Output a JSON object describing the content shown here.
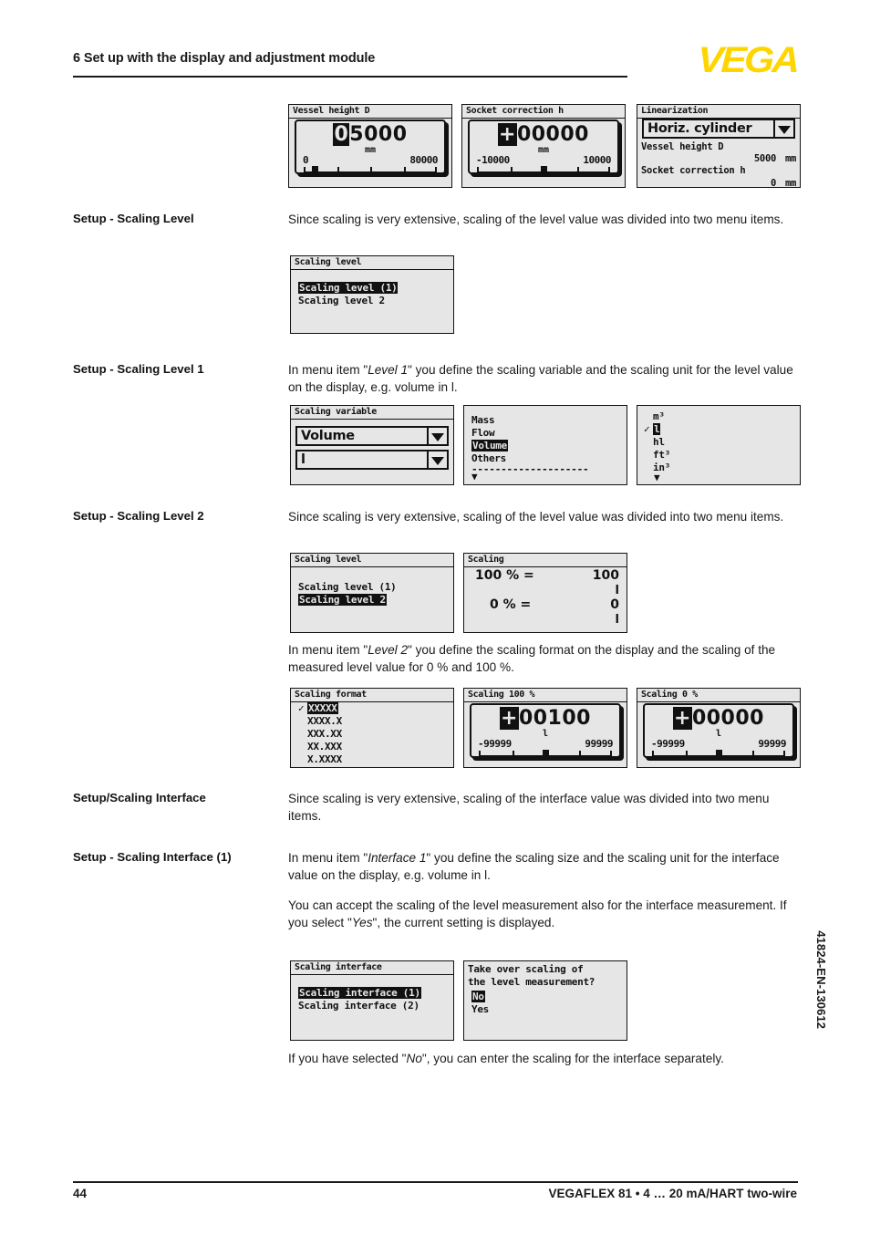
{
  "header": {
    "chapter_title": "6 Set up with the display and adjustment module",
    "logo_text": "VEGA"
  },
  "footer": {
    "page_number": "44",
    "product_line": "VEGAFLEX 81 • 4 … 20 mA/HART two-wire",
    "doc_number": "41824-EN-130612"
  },
  "sections": {
    "scaling_level": {
      "label": "Setup - Scaling Level",
      "body": "Since scaling is very extensive, scaling of the level value was divided into two menu items."
    },
    "scaling_level_1": {
      "label": "Setup - Scaling Level 1",
      "body_1": "In menu item \"",
      "body_em": "Level 1",
      "body_2": "\" you define the scaling variable and the scaling unit for the level value on the display, e.g. volume in l."
    },
    "scaling_level_2": {
      "label": "Setup - Scaling Level 2",
      "body": "Since scaling is very extensive, scaling of the level value was divided into two menu items.",
      "body2_1": "In menu item \"",
      "body2_em": "Level 2",
      "body2_2": "\" you define the scaling format on the display and the scaling of the measured level value for 0 % and 100 %."
    },
    "scaling_interface": {
      "label": "Setup/Scaling Interface",
      "body": "Since scaling is very extensive, scaling of the interface value was divided into two menu items."
    },
    "scaling_interface_1": {
      "label": "Setup - Scaling Interface (1)",
      "body_1": "In menu item \"",
      "body_em": "Interface 1",
      "body_2": "\" you define the scaling size and the scaling unit for the interface value on the display, e.g. volume in l.",
      "body2_1": "You can accept the scaling of the level measurement also for the interface measurement. If you select \"",
      "body2_em": "Yes",
      "body2_2": "\", the current setting is displayed.",
      "body3_1": "If you have selected \"",
      "body3_em": "No",
      "body3_2": "\", you can enter the scaling for the interface separately."
    }
  },
  "screens": {
    "vessel_height": {
      "title": "Vessel height D",
      "cursor_digit": "0",
      "rest_digits": "5000",
      "unit": "mm",
      "min": "0",
      "max": "80000"
    },
    "socket_correction": {
      "title": "Socket correction h",
      "cursor_digit": "+",
      "rest_digits": "00000",
      "unit": "mm",
      "min": "-10000",
      "max": "10000"
    },
    "linearization": {
      "title": "Linearization",
      "selected": "Horiz. cylinder",
      "row1_label": "Vessel height D",
      "row1_value": "5000",
      "row1_unit": "mm",
      "row2_label": "Socket correction h",
      "row2_value": "0",
      "row2_unit": "mm"
    },
    "scaling_level_menu": {
      "title": "Scaling level",
      "items": [
        {
          "label": "Scaling level (1)",
          "selected": true
        },
        {
          "label": "Scaling level 2",
          "selected": false
        }
      ]
    },
    "scaling_variable": {
      "title": "Scaling variable",
      "variable": "Volume",
      "unit": "l"
    },
    "variable_list": {
      "items": [
        {
          "label": "Mass",
          "selected": false
        },
        {
          "label": "Flow",
          "selected": false
        },
        {
          "label": "Volume",
          "selected": true
        },
        {
          "label": "Others",
          "selected": false
        }
      ],
      "divider": "--------------------",
      "more_arrow": "▼"
    },
    "unit_list": {
      "items": [
        {
          "label": "m³",
          "selected": false,
          "check": ""
        },
        {
          "label": "l",
          "selected": true,
          "check": "✓"
        },
        {
          "label": "hl",
          "selected": false,
          "check": ""
        },
        {
          "label": "ft³",
          "selected": false,
          "check": ""
        },
        {
          "label": "in³",
          "selected": false,
          "check": ""
        }
      ],
      "more_arrow": "▼"
    },
    "scaling_level_menu_2": {
      "title": "Scaling level",
      "items": [
        {
          "label": "Scaling level (1)",
          "selected": false
        },
        {
          "label": "Scaling level 2",
          "selected": true
        }
      ]
    },
    "scaling_values": {
      "title": "Scaling",
      "row_100_label": "100 % =",
      "row_100_value": "100",
      "row_100_unit": "l",
      "row_0_label": "0 % =",
      "row_0_value": "0",
      "row_0_unit": "l"
    },
    "scaling_format": {
      "title": "Scaling format",
      "items": [
        {
          "label": "XXXXX",
          "selected": true,
          "check": "✓"
        },
        {
          "label": "XXXX.X",
          "selected": false,
          "check": ""
        },
        {
          "label": "XXX.XX",
          "selected": false,
          "check": ""
        },
        {
          "label": "XX.XXX",
          "selected": false,
          "check": ""
        },
        {
          "label": "X.XXXX",
          "selected": false,
          "check": ""
        }
      ]
    },
    "scaling_100": {
      "title": "Scaling 100 %",
      "cursor_digit": "+",
      "rest_digits": "00100",
      "unit": "l",
      "min": "-99999",
      "max": "99999"
    },
    "scaling_0": {
      "title": "Scaling 0 %",
      "cursor_digit": "+",
      "rest_digits": "00000",
      "unit": "l",
      "min": "-99999",
      "max": "99999"
    },
    "scaling_interface_menu": {
      "title": "Scaling interface",
      "items": [
        {
          "label": "Scaling interface (1)",
          "selected": true
        },
        {
          "label": "Scaling interface (2)",
          "selected": false
        }
      ]
    },
    "take_over": {
      "question_line1": "Take over scaling of",
      "question_line2": "the level measurement?",
      "items": [
        {
          "label": "No",
          "selected": true
        },
        {
          "label": "Yes",
          "selected": false
        }
      ]
    }
  }
}
